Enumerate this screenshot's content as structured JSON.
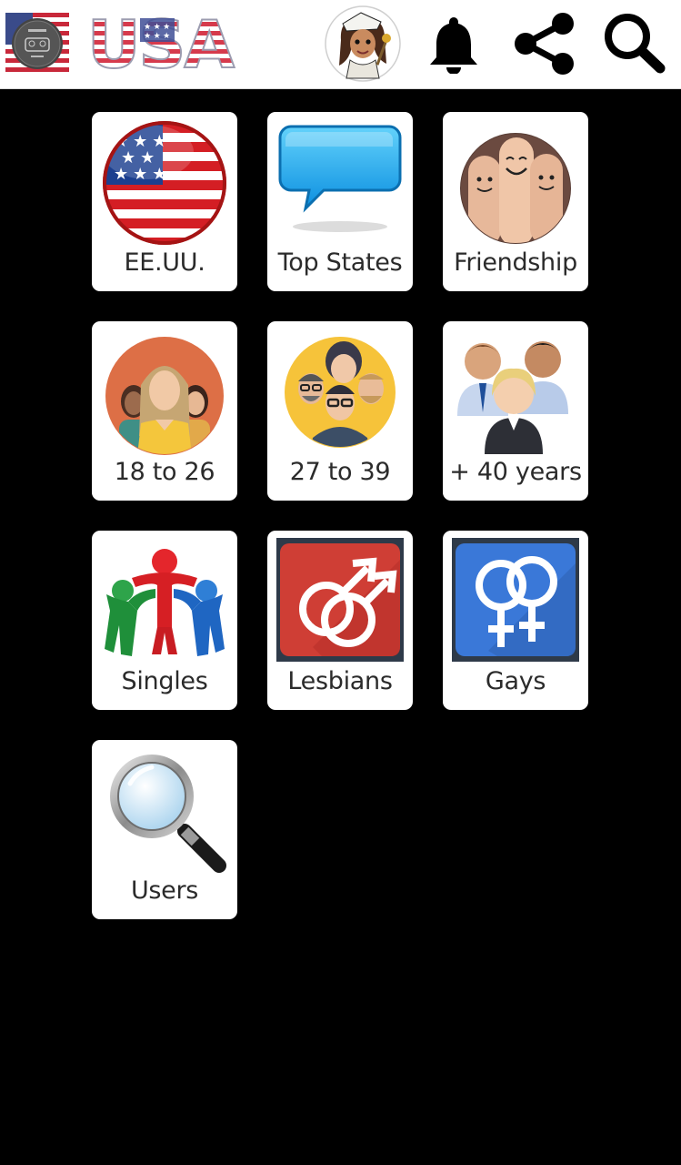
{
  "header": {
    "country_text": "USA",
    "icons": [
      "flag-logo-icon",
      "avatar",
      "bell-icon",
      "share-icon",
      "search-icon"
    ]
  },
  "tiles": [
    {
      "label": "EE.UU.",
      "icon": "usa-flag-globe-icon"
    },
    {
      "label": "Top States",
      "icon": "speech-bubble-icon"
    },
    {
      "label": "Friendship",
      "icon": "smiling-fingers-icon"
    },
    {
      "label": "18 to 26",
      "icon": "young-group-icon"
    },
    {
      "label": "27 to 39",
      "icon": "men-group-icon"
    },
    {
      "label": "+ 40 years",
      "icon": "business-people-icon"
    },
    {
      "label": "Singles",
      "icon": "people-circle-icon"
    },
    {
      "label": "Lesbians",
      "icon": "male-symbols-icon"
    },
    {
      "label": "Gays",
      "icon": "female-symbols-icon"
    },
    {
      "label": "Users",
      "icon": "magnifier-icon"
    }
  ],
  "colors": {
    "background": "#000000",
    "topbar": "#ffffff",
    "tile": "#ffffff",
    "lesbians_tile_art": "#cf3e35",
    "gays_tile_art": "#3a78d8"
  }
}
